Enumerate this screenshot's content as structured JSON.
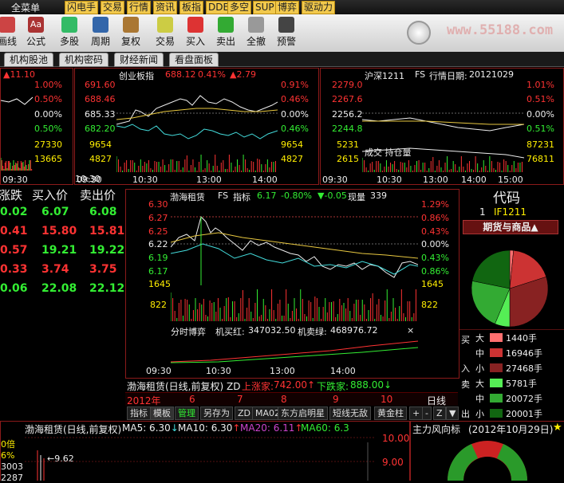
{
  "menu": {
    "main": "全菜单",
    "items": [
      "闪电手",
      "交易",
      "行情",
      "资讯",
      "板指",
      "DDE",
      "多空",
      "SUP",
      "博弈",
      "驱动力"
    ]
  },
  "toolbar": {
    "buttons": [
      "画线",
      "公式",
      "多股",
      "周期",
      "复权",
      "交易",
      "买入",
      "卖出",
      "全撤",
      "预警"
    ]
  },
  "watermark": "www.55188.com",
  "news_tabs": [
    "机构股池",
    "机构密码",
    "财经新闻",
    "看盘面板"
  ],
  "panel_left": {
    "top_change": "11.10",
    "pcts": [
      "1.00%",
      "0.50%",
      "0.00%",
      "0.50%"
    ],
    "vols": [
      "27330",
      "13665"
    ],
    "times": [
      "09:30",
      "10:30"
    ]
  },
  "panel_cyb": {
    "title": "创业板指",
    "last": "688.12",
    "pct": "0.41%",
    "chg": "2.79",
    "left_ticks": [
      "691.60",
      "688.46",
      "685.33",
      "682.20",
      "9654",
      "4827"
    ],
    "right_ticks": [
      "0.91%",
      "0.46%",
      "0.00%",
      "0.46%",
      "9654",
      "4827"
    ],
    "times": [
      "09:30",
      "10:30",
      "13:00",
      "14:00"
    ]
  },
  "panel_hs": {
    "title": "沪深1211",
    "fs": "FS",
    "date_label": "行情日期:",
    "date": "20121029",
    "left_ticks": [
      "2279.0",
      "2267.6",
      "2256.2",
      "2244.8",
      "5231",
      "2615"
    ],
    "right_ticks": [
      "1.01%",
      "0.51%",
      "0.00%",
      "0.51%",
      "87231",
      "76811"
    ],
    "legend": "成交 持仓量",
    "times": [
      "09:30",
      "10:30",
      "13:00",
      "14:00",
      "15:00"
    ]
  },
  "quote_table": {
    "headers": [
      "涨跌",
      "买入价",
      "卖出价"
    ],
    "rows": [
      [
        "0.02",
        "6.07",
        "6.08"
      ],
      [
        "0.41",
        "15.80",
        "15.81"
      ],
      [
        "0.57",
        "19.21",
        "19.22"
      ],
      [
        "0.33",
        "3.74",
        "3.75"
      ],
      [
        "0.06",
        "22.08",
        "22.12"
      ]
    ]
  },
  "center_chart": {
    "name": "渤海租赁",
    "fs": "FS",
    "indicator": "指标",
    "price": "6.17",
    "pct": "-0.80%",
    "chg": "-0.05",
    "now_vol_label": "现量",
    "now_vol": "339",
    "left_ticks": [
      "6.30",
      "6.27",
      "6.25",
      "6.22",
      "6.19",
      "6.17",
      "1645",
      "822"
    ],
    "right_ticks": [
      "1.29%",
      "0.86%",
      "0.43%",
      "0.00%",
      "0.43%",
      "0.86%",
      "1645",
      "822"
    ],
    "sub_title": "分时博弈",
    "buy_label": "机买红:",
    "buy_val": "347032.50",
    "sell_label": "机卖绿:",
    "sell_val": "468976.72",
    "times": [
      "09:30",
      "10:30",
      "13:00",
      "14:00"
    ]
  },
  "info_line": {
    "name": "渤海租赁(日线,前复权) ZD",
    "up_label": "上涨家:",
    "up_val": "742.00",
    "down_label": "下跌家:",
    "down_val": "888.00"
  },
  "month_row": {
    "year": "2012年",
    "months": [
      "6",
      "7",
      "8",
      "9",
      "10"
    ],
    "period": "日线"
  },
  "bottom_tabs": [
    "指标",
    "模板",
    "管理",
    "另存为",
    "ZD",
    "MA02",
    "东方启明星",
    "短线无敌",
    "黄金柱"
  ],
  "daily_chart": {
    "title": "渤海租赁(日线,前复权)",
    "ma5": "MA5: 6.30",
    "ma10": "MA10: 6.30",
    "ma20": "MA20: 6.11",
    "ma60": "MA60: 6.3",
    "price_label": "9.62",
    "ticks": [
      "10.00",
      "9.00"
    ],
    "left_misc": [
      "0倍",
      "6%",
      "3003",
      "2287"
    ]
  },
  "code_panel": {
    "title": "代码",
    "num": "1",
    "code": "IF1211",
    "category": "期货与商品"
  },
  "flow": {
    "buy_label": "买",
    "sell_label": "卖",
    "in_label": "入",
    "out_label": "出",
    "rows": [
      {
        "size": "大",
        "val": "1440手",
        "color": "#ff7070"
      },
      {
        "size": "中",
        "val": "16946手",
        "color": "#cc3333"
      },
      {
        "size": "小",
        "val": "27468手",
        "color": "#882222"
      },
      {
        "size": "大",
        "val": "5781手",
        "color": "#55ee55"
      },
      {
        "size": "中",
        "val": "20072手",
        "color": "#33aa33"
      },
      {
        "size": "小",
        "val": "20001手",
        "color": "#116611"
      }
    ]
  },
  "main_force": {
    "title": "主力风向标",
    "date": "(2012年10月29日)"
  }
}
